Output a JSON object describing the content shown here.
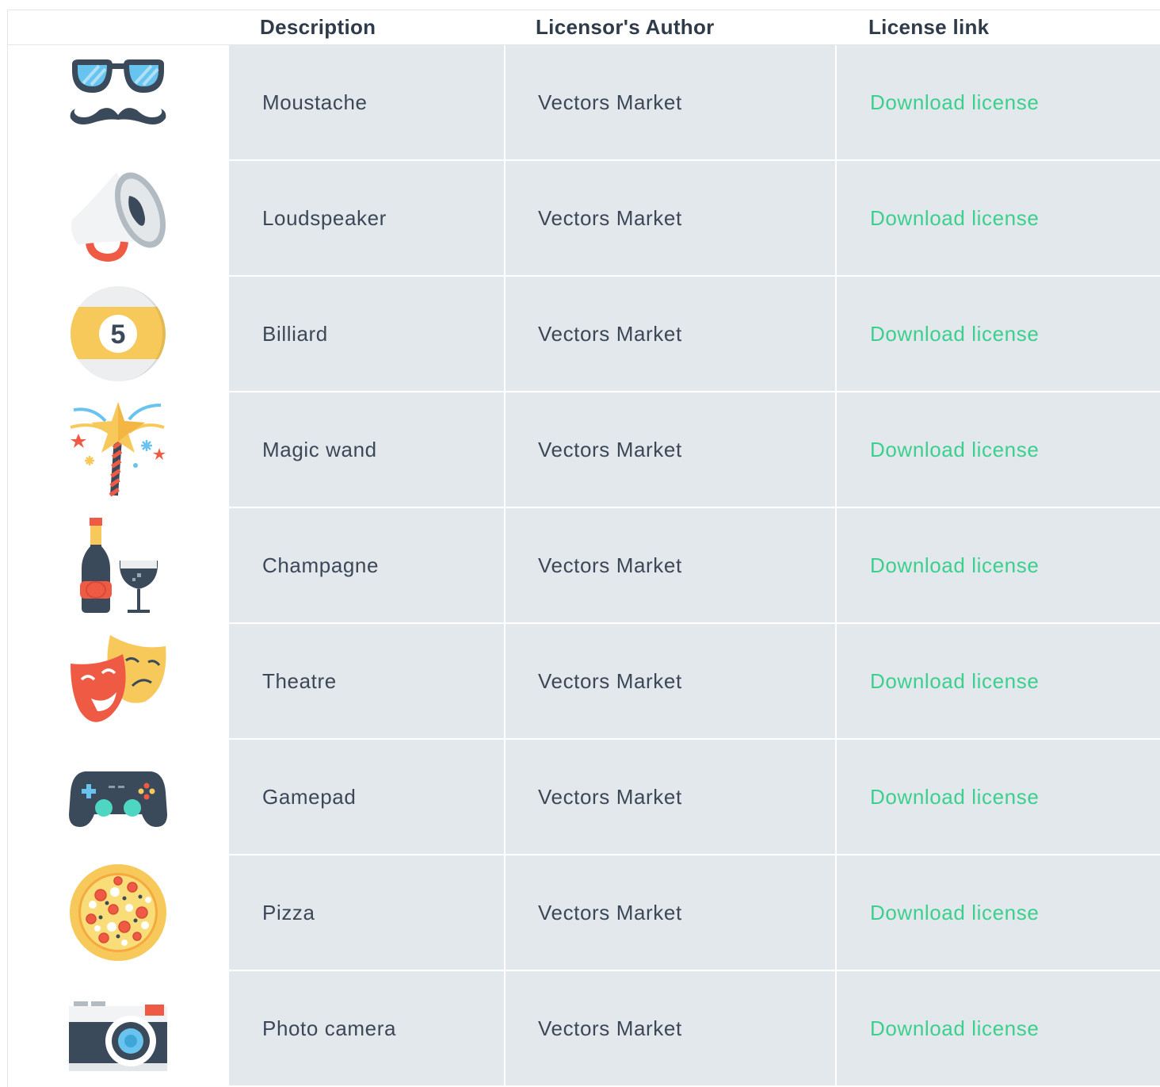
{
  "header": {
    "description": "Description",
    "author": "Licensor's Author",
    "license": "License link"
  },
  "rows": [
    {
      "icon": "moustache-icon",
      "description": "Moustache",
      "author": "Vectors Market",
      "link": "Download license"
    },
    {
      "icon": "loudspeaker-icon",
      "description": "Loudspeaker",
      "author": "Vectors Market",
      "link": "Download license"
    },
    {
      "icon": "billiard-icon",
      "description": "Billiard",
      "author": "Vectors Market",
      "link": "Download license"
    },
    {
      "icon": "magic-wand-icon",
      "description": "Magic wand",
      "author": "Vectors Market",
      "link": "Download license"
    },
    {
      "icon": "champagne-icon",
      "description": "Champagne",
      "author": "Vectors Market",
      "link": "Download license"
    },
    {
      "icon": "theatre-icon",
      "description": "Theatre",
      "author": "Vectors Market",
      "link": "Download license"
    },
    {
      "icon": "gamepad-icon",
      "description": "Gamepad",
      "author": "Vectors Market",
      "link": "Download license"
    },
    {
      "icon": "pizza-icon",
      "description": "Pizza",
      "author": "Vectors Market",
      "link": "Download license"
    },
    {
      "icon": "photo-camera-icon",
      "description": "Photo camera",
      "author": "Vectors Market",
      "link": "Download license"
    }
  ],
  "billiard_number": "5",
  "colors": {
    "link": "#3ccf8e",
    "cell_bg": "#e3e8ec",
    "text": "#3c4857",
    "header_text": "#2f3b4a"
  }
}
